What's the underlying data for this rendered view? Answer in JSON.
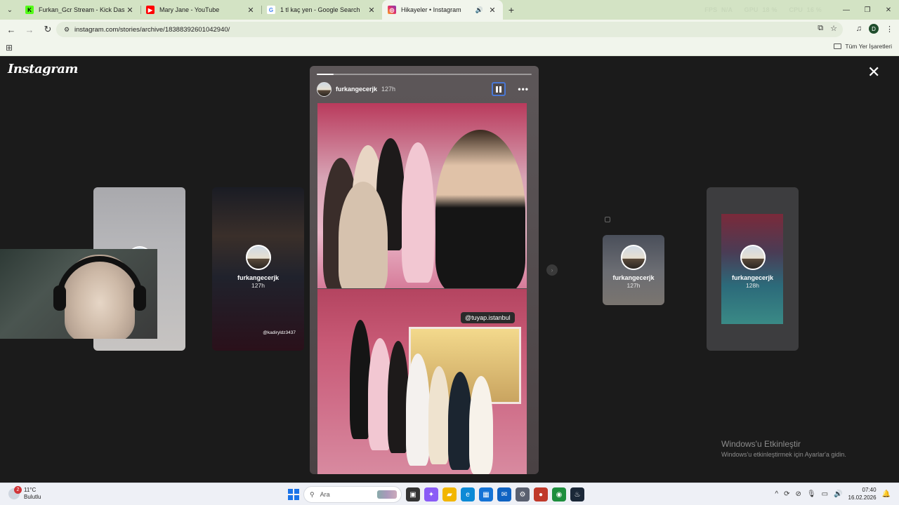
{
  "browser": {
    "tabs": [
      {
        "title": "Furkan_Gcr Stream - Kick Dashb",
        "favicon": "kick-icon",
        "color": "#53fc18",
        "glyph": "K",
        "active": false
      },
      {
        "title": "Mary Jane - YouTube",
        "favicon": "youtube-icon",
        "color": "#ff0000",
        "glyph": "▶",
        "active": false
      },
      {
        "title": "1 tl kaç yen - Google Search",
        "favicon": "google-icon",
        "color": "#4285f4",
        "glyph": "G",
        "active": false
      },
      {
        "title": "Hikayeler • Instagram",
        "favicon": "instagram-icon",
        "color": "#e1306c",
        "glyph": "◎",
        "active": true
      }
    ],
    "stats": {
      "fps_label": "FPS",
      "fps_value": "N/A",
      "gpu_label": "GPU",
      "gpu_value": "18 %",
      "cpu_label": "CPU",
      "cpu_value": "16 %",
      "extra": "FPS N/A"
    },
    "url": "instagram.com/stories/archive/18388392601042940/",
    "profile_initial": "D",
    "bookmarks_all": "Tüm Yer İşaretleri"
  },
  "instagram": {
    "logo": "Instagram",
    "main_story": {
      "username": "furkangecerjk",
      "time": "127h",
      "progress": 0.08,
      "mention_tag": "@tuyap.istanbul"
    },
    "side_cards": [
      {
        "username": "",
        "time": ""
      },
      {
        "username": "furkangecerjk",
        "time": "127h",
        "mention": "@kadiryldz3437"
      },
      {
        "username": "furkangecerjk",
        "time": "127h"
      },
      {
        "username": "furkangecerjk",
        "time": "128h"
      }
    ]
  },
  "watermark": {
    "title": "Windows'u Etkinleştir",
    "subtitle": "Windows'u etkinleştirmek için Ayarlar'a gidin."
  },
  "taskbar": {
    "weather_temp": "11°C",
    "weather_desc": "Bulutlu",
    "weather_badge": "2",
    "search_placeholder": "Ara",
    "time": "07:40",
    "date": "16.02.2026",
    "apps": [
      {
        "name": "task-view-icon",
        "color": "#333333",
        "glyph": "▣"
      },
      {
        "name": "copilot-icon",
        "color": "#8a5cf6",
        "glyph": "✦"
      },
      {
        "name": "file-explorer-icon",
        "color": "#f2b600",
        "glyph": "▰"
      },
      {
        "name": "edge-icon",
        "color": "#0c8ad6",
        "glyph": "e"
      },
      {
        "name": "store-icon",
        "color": "#1573d6",
        "glyph": "▦"
      },
      {
        "name": "outlook-icon",
        "color": "#0f62c2",
        "glyph": "✉"
      },
      {
        "name": "settings-icon",
        "color": "#5a6070",
        "glyph": "⚙"
      },
      {
        "name": "recorder-icon",
        "color": "#c0392b",
        "glyph": "●"
      },
      {
        "name": "chrome-icon",
        "color": "#1e8e3e",
        "glyph": "◉"
      },
      {
        "name": "steam-icon",
        "color": "#1b2838",
        "glyph": "♨"
      }
    ]
  }
}
